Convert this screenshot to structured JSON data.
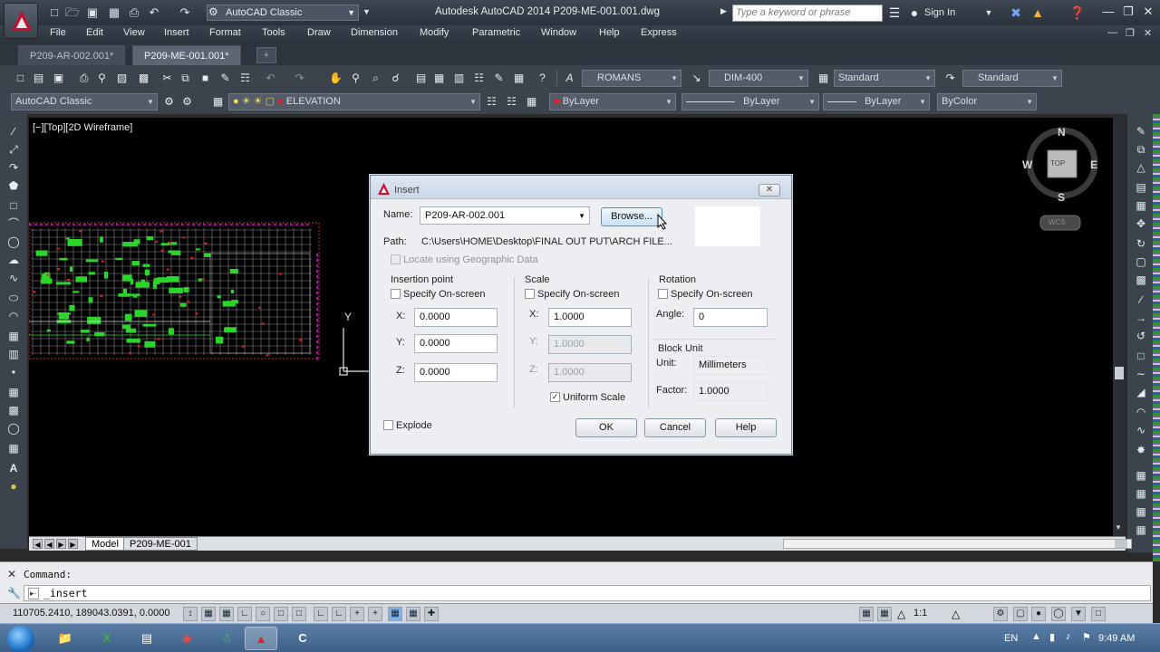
{
  "app": {
    "title": "Autodesk AutoCAD 2014    P209-ME-001.001.dwg",
    "workspace": "AutoCAD Classic",
    "search_placeholder": "Type a keyword or phrase",
    "sign_in": "Sign In"
  },
  "menu": [
    "File",
    "Edit",
    "View",
    "Insert",
    "Format",
    "Tools",
    "Draw",
    "Dimension",
    "Modify",
    "Parametric",
    "Window",
    "Help",
    "Express"
  ],
  "file_tabs": [
    {
      "label": "P209-AR-002.001*",
      "active": false
    },
    {
      "label": "P209-ME-001.001*",
      "active": true
    }
  ],
  "toolbar": {
    "text_style": "ROMANS",
    "dim_style": "DIM-400",
    "table_style": "Standard",
    "multileader_style": "Standard",
    "workspace_combo": "AutoCAD Classic",
    "layer": "ELEVATION",
    "color": "ByLayer",
    "linetype": "ByLayer",
    "lineweight": "ByLayer",
    "plot_style": "ByColor"
  },
  "viewport": {
    "label": "[−][Top][2D Wireframe]",
    "viewcube_face": "TOP",
    "compass": {
      "n": "N",
      "s": "S",
      "e": "E",
      "w": "W"
    },
    "ucs_badge": "WCS",
    "ucs_y": "Y"
  },
  "layout_tabs": [
    "Model",
    "P209-ME-001"
  ],
  "command": {
    "previous": "Command:",
    "current": "_insert"
  },
  "status": {
    "coordinates": "110705.2410, 189043.0391, 0.0000",
    "annotation_scale": "1:1"
  },
  "taskbar": {
    "language": "EN",
    "time": "9:49 AM"
  },
  "dialog": {
    "title": "Insert",
    "name_label": "Name:",
    "name_value": "P209-AR-002.001",
    "browse": "Browse...",
    "path_label": "Path:",
    "path_value": "C:\\Users\\HOME\\Desktop\\FINAL OUT PUT\\ARCH FILE...",
    "geo_label": "Locate using Geographic Data",
    "insertion": {
      "heading": "Insertion point",
      "specify": "Specify On-screen",
      "x_label": "X:",
      "x": "0.0000",
      "y_label": "Y:",
      "y": "0.0000",
      "z_label": "Z:",
      "z": "0.0000"
    },
    "scale": {
      "heading": "Scale",
      "specify": "Specify On-screen",
      "x_label": "X:",
      "x": "1.0000",
      "y_label": "Y:",
      "y": "1.0000",
      "z_label": "Z:",
      "z": "1.0000",
      "uniform": "Uniform Scale",
      "uniform_checked": true
    },
    "rotation": {
      "heading": "Rotation",
      "specify": "Specify On-screen",
      "angle_label": "Angle:",
      "angle": "0"
    },
    "block_unit": {
      "heading": "Block Unit",
      "unit_label": "Unit:",
      "unit": "Millimeters",
      "factor_label": "Factor:",
      "factor": "1.0000"
    },
    "explode": "Explode",
    "ok": "OK",
    "cancel": "Cancel",
    "help": "Help"
  },
  "colors": {
    "accent": "#c8102e",
    "drawing_green": "#2bd62b",
    "drawing_red": "#e0202a",
    "drawing_magenta": "#d21fd2"
  }
}
